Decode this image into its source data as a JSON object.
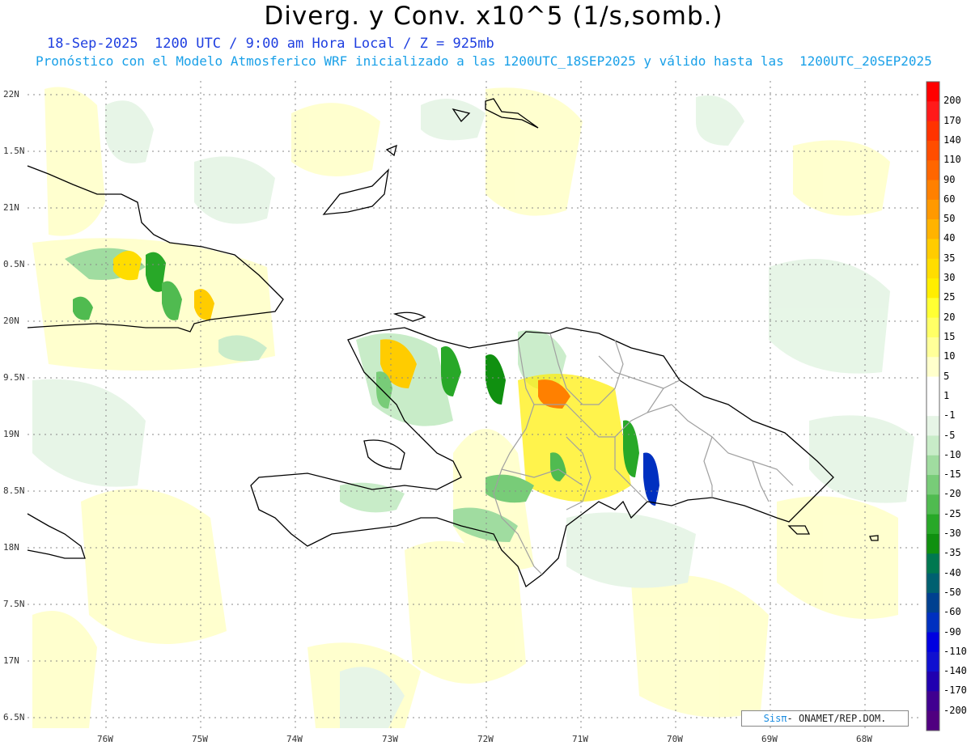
{
  "header": {
    "title": "Diverg. y Conv. x10^5 (1/s,somb.)",
    "subtitle": "18-Sep-2025  1200 UTC / 9:00 am Hora Local / Z = 925mb",
    "subtitle2": "Pronóstico con el Modelo Atmosferico WRF inicializado a las 1200UTC_18SEP2025 y válido hasta las  1200UTC_20SEP2025"
  },
  "axes": {
    "lat_labels": [
      "22N",
      "1.5N",
      "21N",
      "0.5N",
      "20N",
      "9.5N",
      "19N",
      "8.5N",
      "18N",
      "7.5N",
      "17N",
      "6.5N"
    ],
    "lon_labels": [
      "76W",
      "75W",
      "74W",
      "73W",
      "72W",
      "71W",
      "70W",
      "69W",
      "68W"
    ]
  },
  "colorbar": {
    "labels": [
      "200",
      "170",
      "140",
      "110",
      "90",
      "60",
      "50",
      "40",
      "35",
      "30",
      "25",
      "20",
      "15",
      "10",
      "5",
      "1",
      "-1",
      "-5",
      "-10",
      "-15",
      "-20",
      "-25",
      "-30",
      "-35",
      "-40",
      "-50",
      "-60",
      "-90",
      "-110",
      "-140",
      "-170",
      "-200"
    ],
    "colors": [
      "#ff0000",
      "#ff1a1a",
      "#ff3300",
      "#ff4d00",
      "#ff6600",
      "#ff8000",
      "#ff9900",
      "#ffb300",
      "#ffcc00",
      "#ffdd00",
      "#ffee00",
      "#ffff33",
      "#ffff66",
      "#ffff99",
      "#ffffcc",
      "#ffffff",
      "#ffffff",
      "#e6f5e6",
      "#c8ecc8",
      "#a0dca0",
      "#78cc78",
      "#50bb50",
      "#28a828",
      "#109010",
      "#007850",
      "#006070",
      "#004090",
      "#0030c0",
      "#0000e0",
      "#1010d0",
      "#2000b0",
      "#400090",
      "#500080"
    ]
  },
  "credit": {
    "brand": "Sisπ",
    "text": "- ONAMET/REP.DOM."
  },
  "colors": {
    "coast": "#000000",
    "provinces": "#a0a0a0",
    "grid": "#888888",
    "title_blue": "#1f3fe0",
    "subtitle_cyan": "#19a0e8"
  }
}
